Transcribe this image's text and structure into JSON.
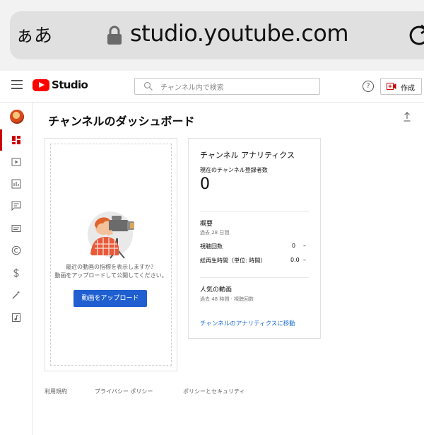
{
  "browser": {
    "text_size_label": "ぁあ",
    "url": "studio.youtube.com"
  },
  "header": {
    "logo_text": "Studio",
    "search_placeholder": "チャンネル内で検索",
    "help_glyph": "?",
    "create_label": "作成"
  },
  "rail": {
    "items": [
      "dashboard",
      "content",
      "analytics",
      "comments",
      "subtitles",
      "copyright",
      "monetization",
      "customization",
      "audio-library"
    ]
  },
  "main": {
    "title": "チャンネルのダッシュボード",
    "upload_card": {
      "prompt_line1": "最近の動画の指標を表示しますか？",
      "prompt_line2": "動画をアップロードして公開してください。",
      "button_label": "動画をアップロード"
    },
    "analytics_card": {
      "title": "チャンネル アナリティクス",
      "subscribers_label": "現在のチャンネル登録者数",
      "subscribers_value": "0",
      "summary_title": "概要",
      "summary_period": "過去 28 日間",
      "views_label": "視聴回数",
      "views_value": "0",
      "views_delta": "–",
      "watch_label": "総再生時間（単位: 時間）",
      "watch_value": "0.0",
      "watch_delta": "–",
      "top_videos_title": "人気の動画",
      "top_videos_period": "過去 48 時間 · 視聴回数",
      "link": "チャンネルのアナリティクスに移動"
    }
  },
  "footer": {
    "terms": "利用規約",
    "privacy": "プライバシー ポリシー",
    "policy_safety": "ポリシーとセキュリティ"
  }
}
